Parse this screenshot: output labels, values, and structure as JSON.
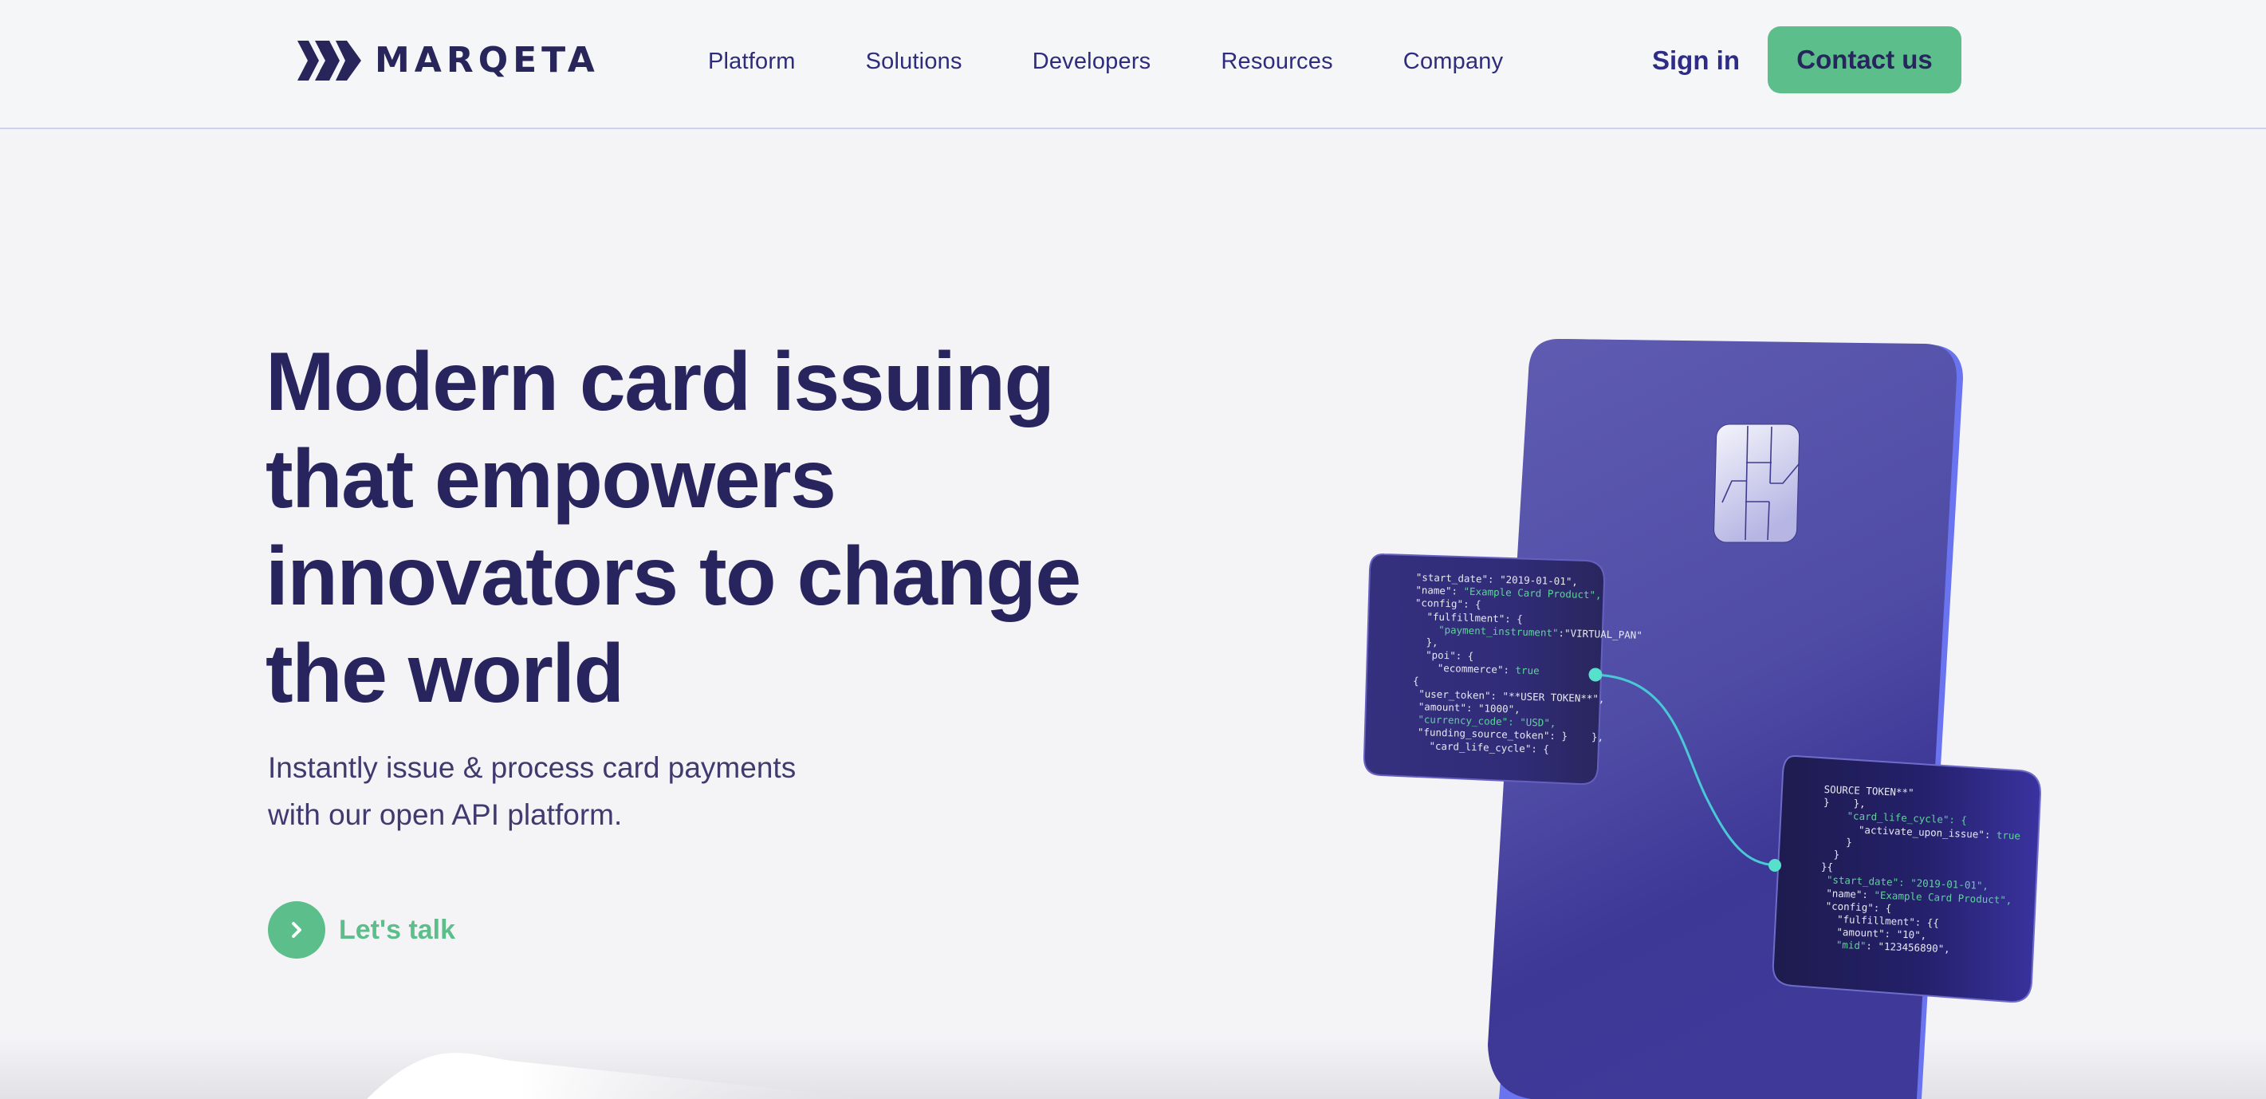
{
  "header": {
    "logo_text": "MARQETA",
    "nav": [
      {
        "label": "Platform"
      },
      {
        "label": "Solutions"
      },
      {
        "label": "Developers"
      },
      {
        "label": "Resources"
      },
      {
        "label": "Company"
      }
    ],
    "sign_in_label": "Sign in",
    "contact_label": "Contact us"
  },
  "hero": {
    "title": "Modern card issuing that empowers innovators to change the world",
    "subtitle_line1": "Instantly issue & process card payments",
    "subtitle_line2": "with our open API platform.",
    "cta_label": "Let's talk",
    "cta_icon": "chevron-right-icon"
  },
  "illustration": {
    "left_panel_code": [
      [
        "\"start_date\": \"2019-01-01\",",
        ""
      ],
      [
        "\"name\": ",
        "\"Example Card Product\","
      ],
      [
        "\"config\": {",
        ""
      ],
      [
        "  \"fulfillment\": {",
        ""
      ],
      [
        "    ",
        "\"payment_instrument\"",
        ":\"VIRTUAL_PAN\""
      ],
      [
        "  },",
        ""
      ],
      [
        "  \"poi\": {",
        ""
      ],
      [
        "    \"ecommerce\": ",
        "true"
      ],
      [
        "{",
        ""
      ],
      [
        " \"user_token\": \"**USER TOKEN**\",",
        ""
      ],
      [
        " \"amount\": \"1000\",",
        ""
      ],
      [
        " ",
        "\"currency_code\": \"USD\","
      ],
      [
        " \"funding_source_token\": }    },",
        ""
      ],
      [
        "   \"card_life_cycle\": {",
        ""
      ]
    ],
    "right_panel_code": [
      [
        "SOURCE TOKEN**\"",
        ""
      ],
      [
        "}    },",
        ""
      ],
      [
        "    ",
        "\"card_life_cycle\": {"
      ],
      [
        "      \"activate_upon_issue\": ",
        "true"
      ],
      [
        "    }",
        ""
      ],
      [
        "  }",
        ""
      ],
      [
        "}{",
        ""
      ],
      [
        " ",
        "\"start_date\": \"2019-01-01\","
      ],
      [
        " \"name\": ",
        "\"Example Card Product\","
      ],
      [
        " \"config\": {",
        ""
      ],
      [
        "   \"fulfillment\": {{",
        ""
      ],
      [
        "   \"amount\": \"10\",",
        ""
      ],
      [
        "   ",
        "\"mid\"",
        ": \"123456890\","
      ]
    ]
  },
  "colors": {
    "brand_navy": "#28245e",
    "accent_green": "#5cbe8a",
    "card_purple": "#5a57b0",
    "connector_teal": "#4fd6c8"
  }
}
